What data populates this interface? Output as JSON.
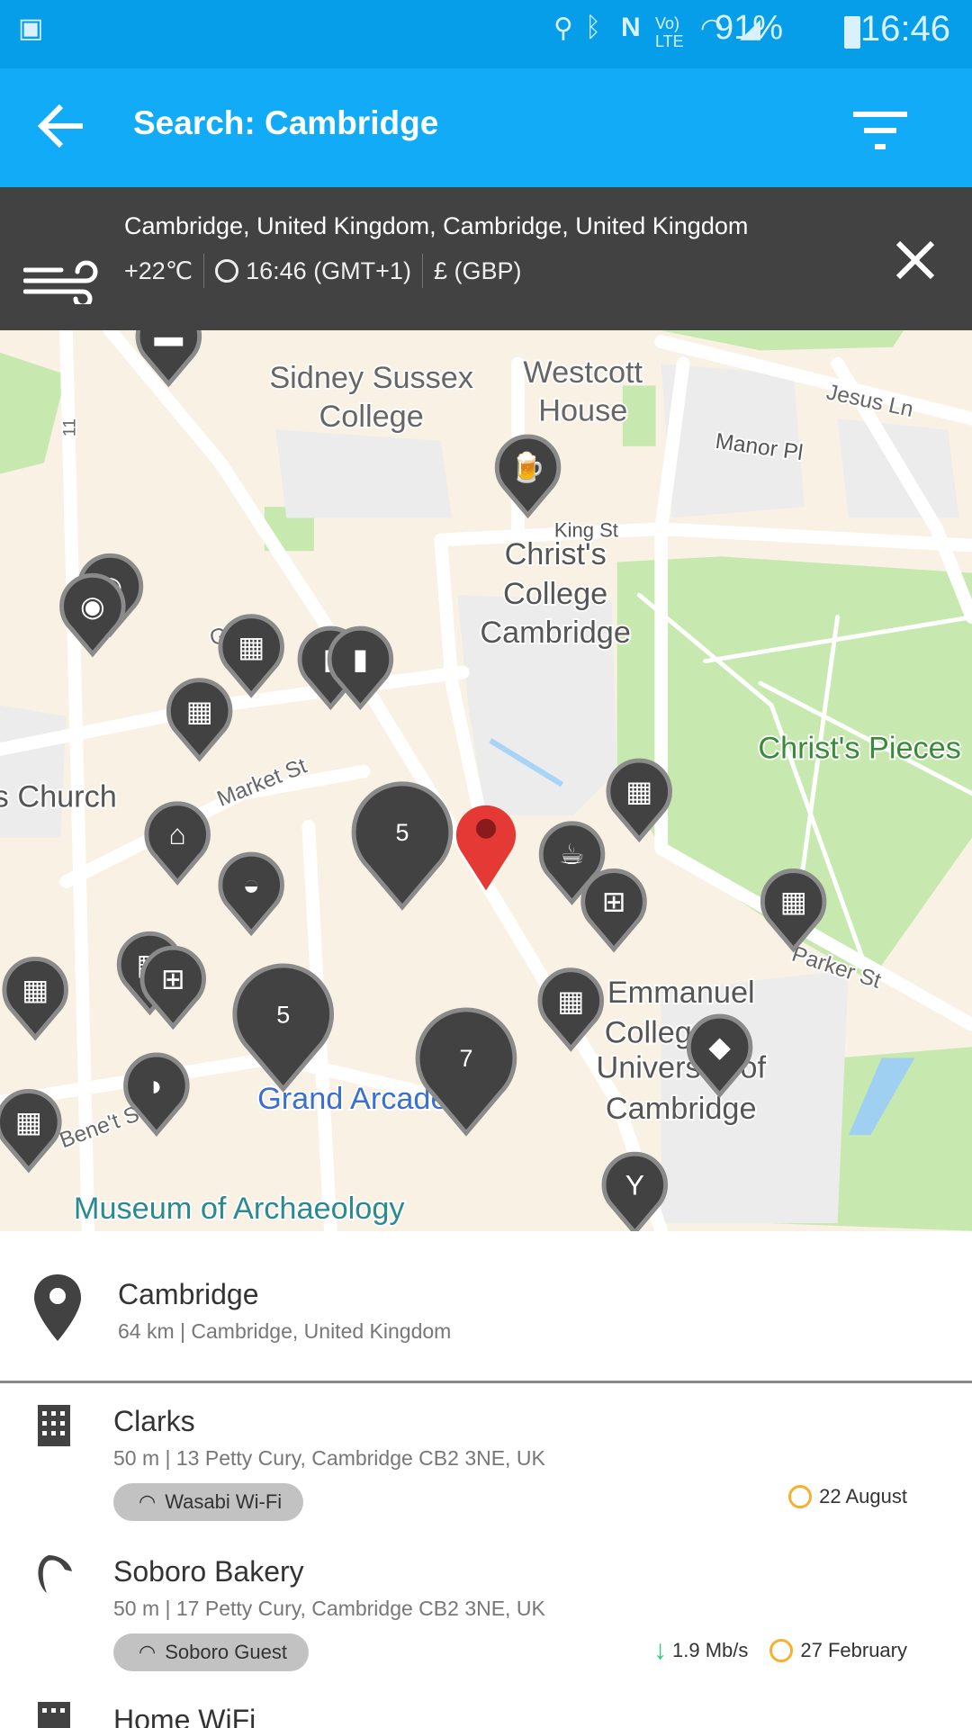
{
  "status_bar": {
    "battery": "91%",
    "time": "16:46",
    "icons": [
      "gallery-icon",
      "location-icon",
      "bluetooth-icon",
      "nfc-icon",
      "volte-icon",
      "wifi-icon",
      "signal-icon",
      "battery-icon"
    ]
  },
  "app_bar": {
    "title": "Search: Cambridge",
    "back_icon": "arrow-left-icon",
    "filter_icon": "filter-icon"
  },
  "info_bar": {
    "location": "Cambridge, United Kingdom, Cambridge, United Kingdom",
    "temperature": "+22℃",
    "time": "16:46 (GMT+1)",
    "currency": "£ (GBP)",
    "weather_icon": "wind-icon"
  },
  "map": {
    "labels": [
      "Sidney Sussex",
      "College",
      "Westcott",
      "House",
      "Jesus Ln",
      "Manor Pl",
      "King St",
      "Christ's",
      "College",
      "Cambridge",
      "Christ's Pieces",
      "s Church",
      "Market St",
      "Parker St",
      "Emmanuel",
      "College",
      "University of",
      "Cambridge",
      "Grand Arcade",
      "Museum of Archaeology",
      "Bene't St",
      "Gr    St",
      "11"
    ],
    "clusters": [
      "5",
      "5",
      "7"
    ],
    "colors": {
      "road": "#ffffff",
      "land": "#f8f1e4",
      "park": "#c7e9b0",
      "block": "#ececec",
      "pin": "#424242",
      "selected": "#e53935"
    }
  },
  "results": [
    {
      "name": "Cambridge",
      "detail": "64 km | Cambridge, United Kingdom",
      "icon": "map-pin-icon"
    },
    {
      "name": "Clarks",
      "detail": "50 m | 13 Petty Cury, Cambridge CB2 3NE, UK",
      "icon": "building-icon",
      "network": "Wasabi Wi-Fi",
      "date": "22 August"
    },
    {
      "name": "Soboro Bakery",
      "detail": "50 m | 17 Petty Cury, Cambridge CB2 3NE, UK",
      "icon": "croissant-icon",
      "network": "Soboro Guest",
      "speed": "1.9 Mb/s",
      "date": "27 February"
    },
    {
      "name": "Home WiFi",
      "icon": "building-icon"
    }
  ]
}
